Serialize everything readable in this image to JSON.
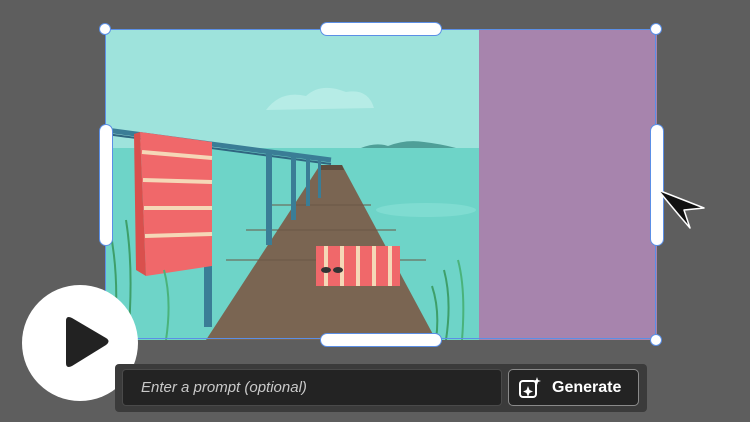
{
  "canvas": {
    "scene": "boardwalk-pier-illustration",
    "extension_fill": "#a784ad",
    "selection_color": "#5b8fe6"
  },
  "player": {
    "icon": "play-icon"
  },
  "cursor": {
    "icon": "arrow-cursor-icon"
  },
  "prompt_bar": {
    "placeholder": "Enter a prompt (optional)",
    "generate_label": "Generate",
    "generate_icon": "sparkle-image-icon"
  }
}
